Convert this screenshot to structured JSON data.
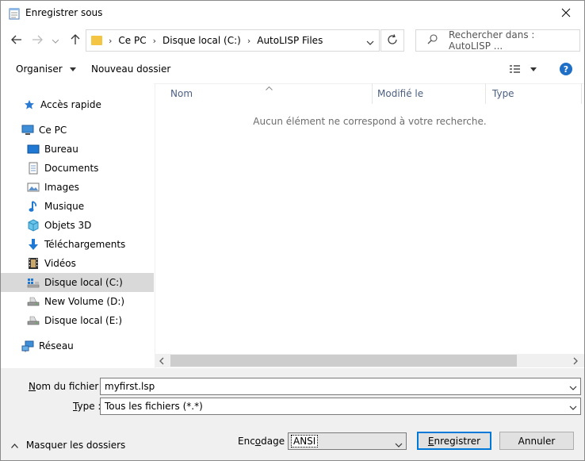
{
  "window": {
    "title": "Enregistrer sous"
  },
  "address": {
    "crumbs": [
      "Ce PC",
      "Disque local (C:)",
      "AutoLISP Files"
    ]
  },
  "search": {
    "placeholder": "Rechercher dans : AutoLISP ..."
  },
  "toolbar": {
    "organize": "Organiser",
    "new_folder": "Nouveau dossier"
  },
  "nav": {
    "items": [
      {
        "label": "Accès rapide"
      },
      {
        "label": "Ce PC"
      },
      {
        "label": "Bureau"
      },
      {
        "label": "Documents"
      },
      {
        "label": "Images"
      },
      {
        "label": "Musique"
      },
      {
        "label": "Objets 3D"
      },
      {
        "label": "Téléchargements"
      },
      {
        "label": "Vidéos"
      },
      {
        "label": "Disque local (C:)"
      },
      {
        "label": "New Volume (D:)"
      },
      {
        "label": "Disque local (E:)"
      },
      {
        "label": "Réseau"
      }
    ]
  },
  "columns": {
    "name": "Nom",
    "modified": "Modifié le",
    "type": "Type"
  },
  "content": {
    "empty_message": "Aucun élément ne correspond à votre recherche."
  },
  "form": {
    "filename_label_u": "N",
    "filename_label_rest": "om du fichier :",
    "filename_value": "myfirst.lsp",
    "type_label_u": "T",
    "type_label_rest": "ype :",
    "type_value": "Tous les fichiers  (*.*)",
    "hide_folders": "Masquer les dossiers",
    "encoding_label_pre": "Enc",
    "encoding_label_u": "o",
    "encoding_label_rest": "dage :",
    "encoding_value": "ANSI",
    "save_u": "E",
    "save_rest": "nregistrer",
    "cancel": "Annuler"
  },
  "colors": {
    "accent": "#0078d7",
    "selected_bg": "#d9d9d9",
    "header_text": "#4d6082"
  }
}
